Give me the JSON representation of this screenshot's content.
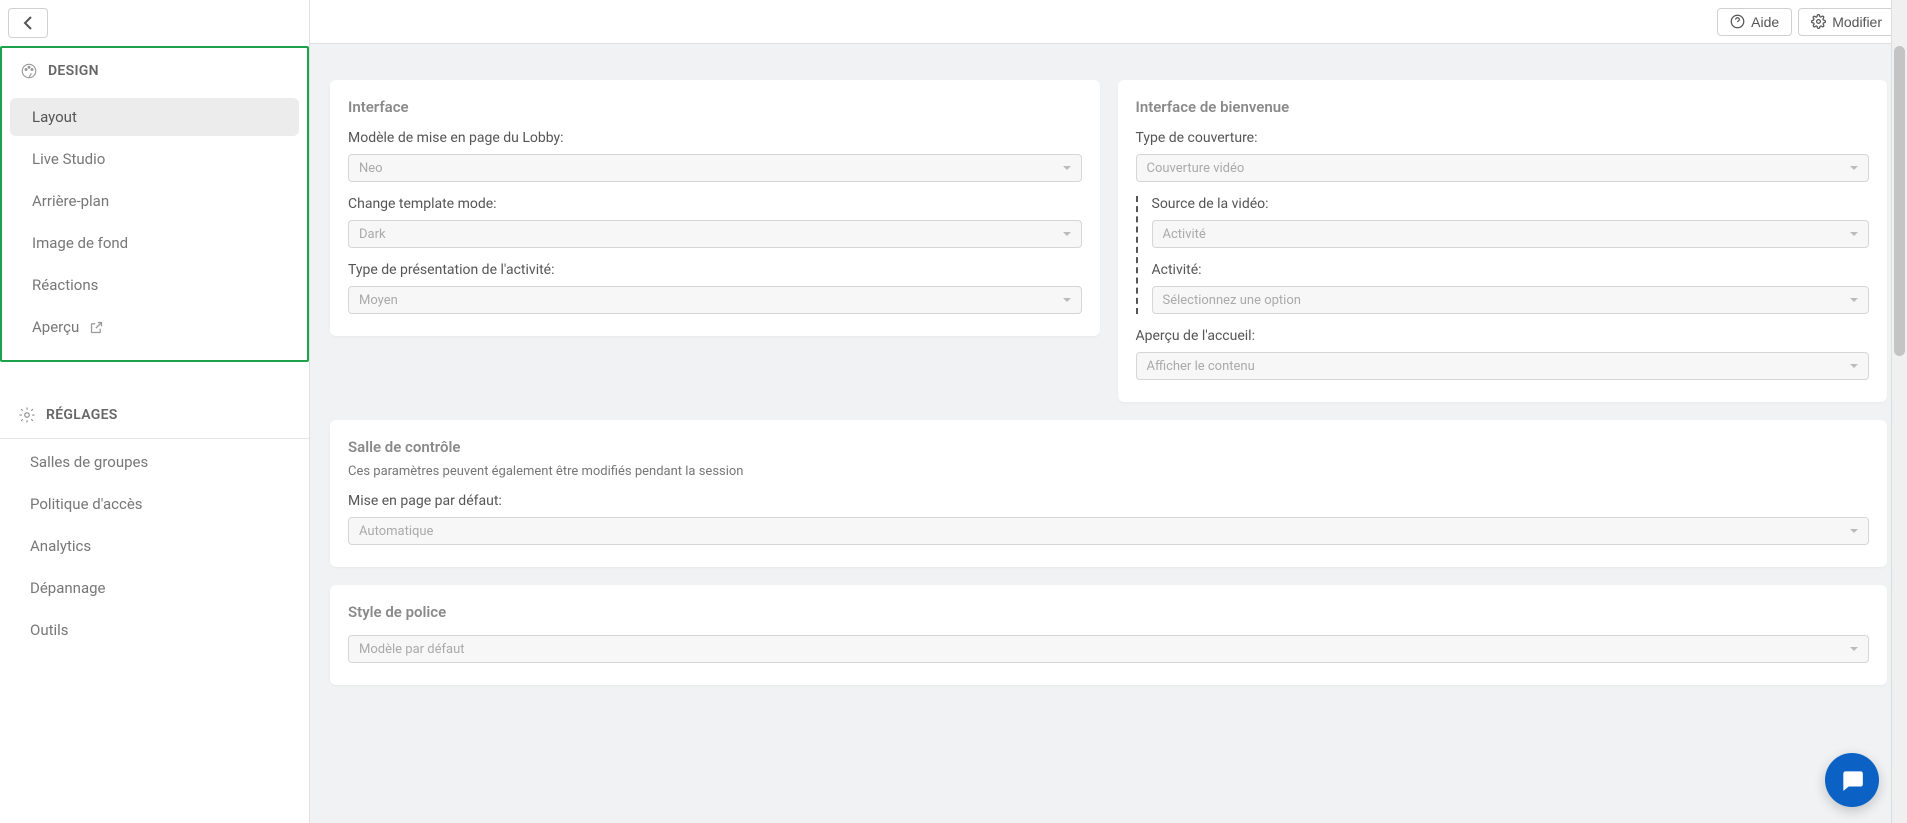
{
  "topbar": {
    "help_label": "Aide",
    "modify_label": "Modifier"
  },
  "sidebar": {
    "design_header": "DESIGN",
    "design_items": [
      {
        "label": "Layout",
        "active": true
      },
      {
        "label": "Live Studio"
      },
      {
        "label": "Arrière-plan"
      },
      {
        "label": "Image de fond"
      },
      {
        "label": "Réactions"
      },
      {
        "label": "Aperçu",
        "external": true
      }
    ],
    "reglages_header": "RÉGLAGES",
    "reglages_items": [
      {
        "label": "Salles de groupes"
      },
      {
        "label": "Politique d'accès"
      },
      {
        "label": "Analytics"
      },
      {
        "label": "Dépannage"
      },
      {
        "label": "Outils"
      }
    ]
  },
  "cards": {
    "interface": {
      "title": "Interface",
      "lobby_label": "Modèle de mise en page du Lobby:",
      "lobby_value": "Neo",
      "template_mode_label": "Change template mode:",
      "template_mode_value": "Dark",
      "presentation_label": "Type de présentation de l'activité:",
      "presentation_value": "Moyen"
    },
    "welcome": {
      "title": "Interface de bienvenue",
      "cover_type_label": "Type de couverture:",
      "cover_type_value": "Couverture vidéo",
      "video_source_label": "Source de la vidéo:",
      "video_source_value": "Activité",
      "activity_label": "Activité:",
      "activity_value": "Sélectionnez une option",
      "home_preview_label": "Aperçu de l'accueil:",
      "home_preview_value": "Afficher le contenu"
    },
    "control_room": {
      "title": "Salle de contrôle",
      "subtitle": "Ces paramètres peuvent également être modifiés pendant la session",
      "default_layout_label": "Mise en page par défaut:",
      "default_layout_value": "Automatique"
    },
    "font_style": {
      "title": "Style de police",
      "value": "Modèle par défaut"
    }
  }
}
